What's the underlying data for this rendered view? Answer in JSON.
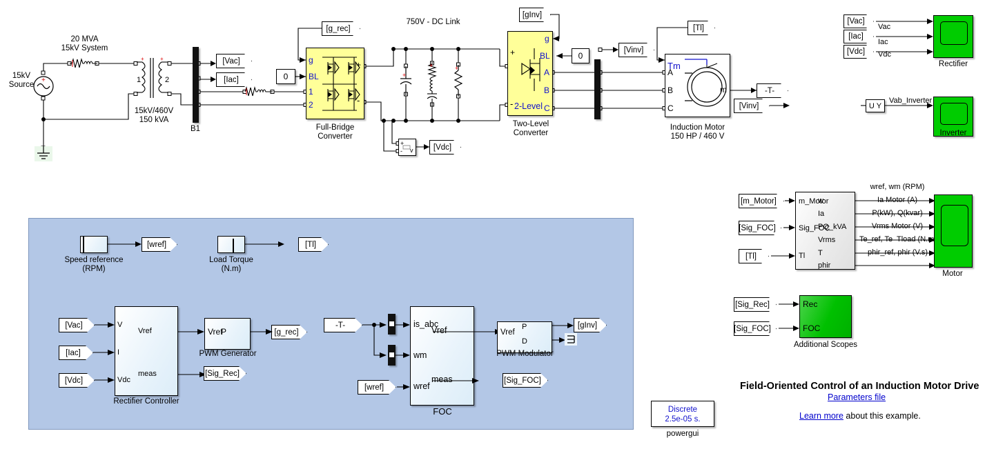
{
  "diagram": {
    "title": "Field-Oriented Control of an Induction Motor Drive",
    "parameters_link": "Parameters file",
    "learnmore_link": "Learn more",
    "learnmore_tail": " about this example."
  },
  "power": {
    "source_label": "15kV\nSource",
    "system_label": "20 MVA\n15kV System",
    "transformer_label": "15kV/460V\n150 kVA",
    "transformer_w1": "1",
    "transformer_w2": "2",
    "bus1": "B1",
    "dclink_label": "750V - DC Link",
    "fullbridge_label": "Full-Bridge\nConverter",
    "twolevel_label": "Two-Level\nConverter",
    "twolevel_inner": "2-Level",
    "motor_label": "Induction Motor\n150 HP / 460 V",
    "const_zero_rec": "0",
    "const_zero_inv": "0",
    "fb_ports": {
      "g": "g",
      "bl": "BL",
      "p1": "1",
      "p2": "2",
      "plus": "+",
      "minus": "-"
    },
    "tl_ports": {
      "plus": "+",
      "minus": "-",
      "g": "g",
      "bl": "BL",
      "a": "A",
      "b": "B",
      "c": "C"
    },
    "motor_ports": {
      "tm": "Tm",
      "a": "A",
      "b": "B",
      "c": "C",
      "m": "m"
    },
    "vmeas": {
      "plus": "+",
      "minus": "-",
      "v": "v"
    },
    "tags": {
      "g_rec": "[g_rec]",
      "vac": "[Vac]",
      "iac": "[Iac]",
      "vdc": "[Vdc]",
      "ginv": "[gInv]",
      "vinv": "[Vinv]",
      "tl": "[Tl]",
      "minus_t": "-T-"
    }
  },
  "scopes": {
    "rectifier": {
      "name": "Rectifier",
      "from_tags": [
        "[Vac]",
        "[Iac]",
        "[Vdc]"
      ],
      "signal_labels": [
        "Vac",
        "Iac",
        "Vdc"
      ]
    },
    "inverter": {
      "name": "Inverter",
      "from_tag": "[Vinv]",
      "uy_block": "U Y",
      "signal_label": "Vab_Inverter"
    },
    "motor": {
      "name": "Motor",
      "from_tags": [
        "[m_Motor]",
        "[Sig_FOC]",
        "[Tl]"
      ],
      "in_ports": [
        "m_Motor",
        "Sig_FOC",
        "Tl"
      ],
      "out_ports": [
        "w",
        "Ia",
        "PQ_kVA",
        "Vrms",
        "T",
        "phir"
      ],
      "signal_labels": [
        "wref, wm (RPM)",
        "Ia Motor (A)",
        "P(kW), Q(kvar)",
        "Vrms Motor (V)",
        "Te_ref, Te  Tload (N.m)",
        "phir_ref, phir (V.s)"
      ]
    },
    "additional": {
      "name": "Additional Scopes",
      "from_tags": [
        "[Sig_Rec]",
        "[Sig_FOC]"
      ],
      "in_ports": [
        "Rec",
        "FOC"
      ]
    }
  },
  "control": {
    "speed_reference_label": "Speed reference\n(RPM)",
    "speed_reference_tag": "[wref]",
    "load_torque_label": "Load Torque\n(N.m)",
    "load_torque_tag": "[Tl]",
    "rectifier_controller": {
      "label": "Rectifier Controller",
      "from_tags": [
        "[Vac]",
        "[Iac]",
        "[Vdc]"
      ],
      "in_ports": [
        "V",
        "I",
        "Vdc"
      ],
      "out_ports": [
        "Vref",
        "meas"
      ],
      "meas_tag": "[Sig_Rec]"
    },
    "pwm_generator": {
      "label": "PWM Generator",
      "in_port": "Vref",
      "out_port": "P",
      "out_tag": "[g_rec]"
    },
    "foc": {
      "label": "FOC",
      "in_tag_current": "-T-",
      "in_tag_wref": "[wref]",
      "in_ports": [
        "is_abc",
        "wm",
        "wref"
      ],
      "out_ports": [
        "Vref",
        "meas"
      ],
      "meas_tag": "[Sig_FOC]"
    },
    "pwm_modulator": {
      "label": "PWM Modulator",
      "in_port": "Vref",
      "out_ports": [
        "P",
        "D"
      ],
      "out_tag": "[gInv]"
    }
  },
  "powergui": {
    "line1": "Discrete",
    "line2": "2.5e-05 s.",
    "label": "powergui"
  },
  "colors": {
    "panel": "#b3c7e6",
    "converter": "#ffff99",
    "scope": "#00cc00",
    "subsystem": "#dcedf8",
    "link": "#0000cc",
    "port_text": "#1111cc"
  }
}
